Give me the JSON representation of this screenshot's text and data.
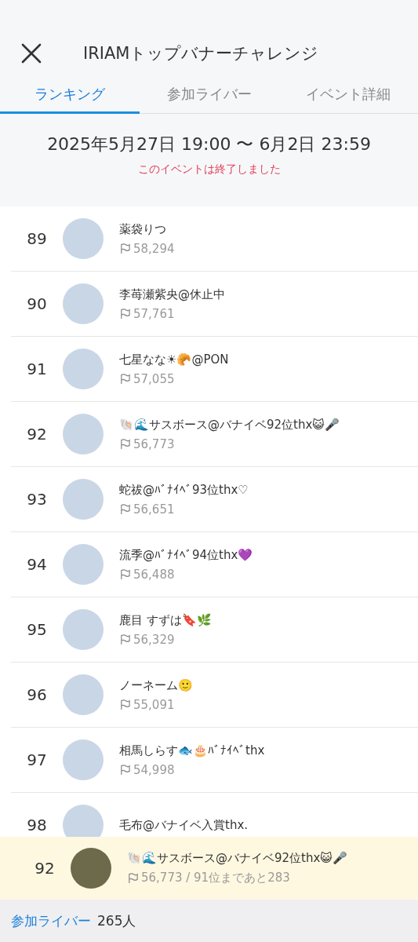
{
  "header": {
    "title": "IRIAMトップバナーチャレンジ"
  },
  "tabs": [
    {
      "label": "ランキング",
      "selected": true
    },
    {
      "label": "参加ライバー",
      "selected": false
    },
    {
      "label": "イベント詳細",
      "selected": false
    }
  ],
  "period": "2025年5月27日 19:00 〜 6月2日 23:59",
  "status": "このイベントは終了しました",
  "ranking": [
    {
      "rank": "89",
      "name": "薬袋りつ",
      "score": "58,294"
    },
    {
      "rank": "90",
      "name": "李苺瀬紫央@休止中",
      "score": "57,761"
    },
    {
      "rank": "91",
      "name": "七星なな☀🥐@PON",
      "score": "57,055"
    },
    {
      "rank": "92",
      "name": "🐚🌊サスボース@バナイベ92位thx😺🎤",
      "score": "56,773"
    },
    {
      "rank": "93",
      "name": "蛇祓@ﾊﾞﾅｲﾍﾞ93位thx♡",
      "score": "56,651"
    },
    {
      "rank": "94",
      "name": "流季@ﾊﾞﾅｲﾍﾞ94位thx💜",
      "score": "56,488"
    },
    {
      "rank": "95",
      "name": "鹿目 すずは🔖🌿",
      "score": "56,329"
    },
    {
      "rank": "96",
      "name": "ノーネーム🙂",
      "score": "55,091"
    },
    {
      "rank": "97",
      "name": "相馬しらす🐟🎂ﾊﾞﾅｲﾍﾞthx",
      "score": "54,998"
    },
    {
      "rank": "98",
      "name": "毛布@バナイベ入賞thx."
    }
  ],
  "my_rank": {
    "rank": "92",
    "name": "🐚🌊サスボース@バナイベ92位thx😺🎤",
    "score": "56,773 / 91位まであと283"
  },
  "footer": {
    "label": "参加ライバー",
    "count": "265人"
  }
}
